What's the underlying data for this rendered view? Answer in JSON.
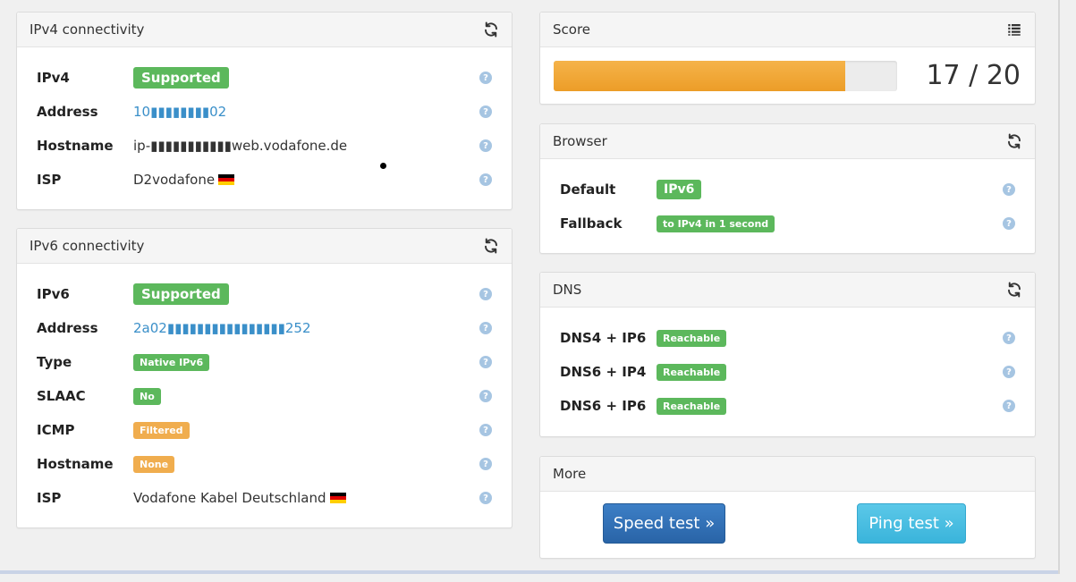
{
  "ipv4": {
    "title": "IPv4 connectivity",
    "rows": [
      {
        "label": "IPv4",
        "value": "Supported"
      },
      {
        "label": "Address",
        "value": "10▮▮▮▮▮▮▮▮02"
      },
      {
        "label": "Hostname",
        "value": "ip-▮▮▮▮▮▮▮▮▮▮▮web.vodafone.de"
      },
      {
        "label": "ISP",
        "value": "D2vodafone"
      }
    ]
  },
  "ipv6": {
    "title": "IPv6 connectivity",
    "rows": [
      {
        "label": "IPv6",
        "value": "Supported"
      },
      {
        "label": "Address",
        "value": "2a02▮▮▮▮▮▮▮▮▮▮▮▮▮▮▮▮252"
      },
      {
        "label": "Type",
        "value": "Native IPv6"
      },
      {
        "label": "SLAAC",
        "value": "No"
      },
      {
        "label": "ICMP",
        "value": "Filtered"
      },
      {
        "label": "Hostname",
        "value": "None"
      },
      {
        "label": "ISP",
        "value": "Vodafone Kabel Deutschland"
      }
    ]
  },
  "score": {
    "title": "Score",
    "text": "17 / 20",
    "fraction": 0.85
  },
  "browser": {
    "title": "Browser",
    "rows": [
      {
        "label": "Default",
        "value": "IPv6"
      },
      {
        "label": "Fallback",
        "value": "to IPv4 in 1 second"
      }
    ]
  },
  "dns": {
    "title": "DNS",
    "rows": [
      {
        "label": "DNS4 + IP6",
        "value": "Reachable"
      },
      {
        "label": "DNS6 + IP4",
        "value": "Reachable"
      },
      {
        "label": "DNS6 + IP6",
        "value": "Reachable"
      }
    ]
  },
  "more": {
    "title": "More",
    "speed_test": "Speed test »",
    "ping_test": "Ping test »"
  },
  "help_glyph": "?",
  "colors": {
    "success": "#5cb85c",
    "warning": "#f0ad4e",
    "link": "#3a8fc9",
    "score_bar": "#ec9d28"
  },
  "icons": {
    "refresh": "refresh-icon",
    "list": "list-icon",
    "help": "question-circle-icon",
    "flag": "german-flag-icon"
  }
}
